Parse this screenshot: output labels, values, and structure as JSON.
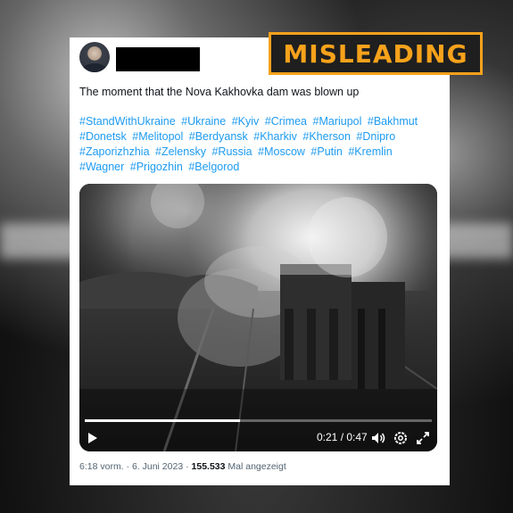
{
  "badge": {
    "label": "MISLEADING",
    "color": "#f7a21b"
  },
  "tweet": {
    "text": "The moment that the Nova Kakhovka dam was blown up",
    "hashtags": [
      "#StandWithUkraine",
      "#Ukraine",
      "#Kyiv",
      "#Crimea",
      "#Mariupol",
      "#Bakhmut",
      "#Donetsk",
      "#Melitopol",
      "#Berdyansk",
      "#Kharkiv",
      "#Kherson",
      "#Dnipro",
      "#Zaporizhzhia",
      "#Zelensky",
      "#Russia",
      "#Moscow",
      "#Putin",
      "#Kremlin",
      "#Wagner",
      "#Prigozhin",
      "#Belgorod"
    ],
    "hashtag_color": "#1d9bf0"
  },
  "video": {
    "current_time": "0:21",
    "duration": "0:47",
    "time_display": "0:21 / 0:47",
    "progress_fraction": 0.447,
    "icons": [
      "play-icon",
      "volume-icon",
      "settings-icon",
      "fullscreen-icon"
    ]
  },
  "meta": {
    "time": "6:18 vorm.",
    "separator1": " · ",
    "date": "6. Juni 2023",
    "separator2": " · ",
    "views": "155.533",
    "views_label": " Mal angezeigt"
  }
}
